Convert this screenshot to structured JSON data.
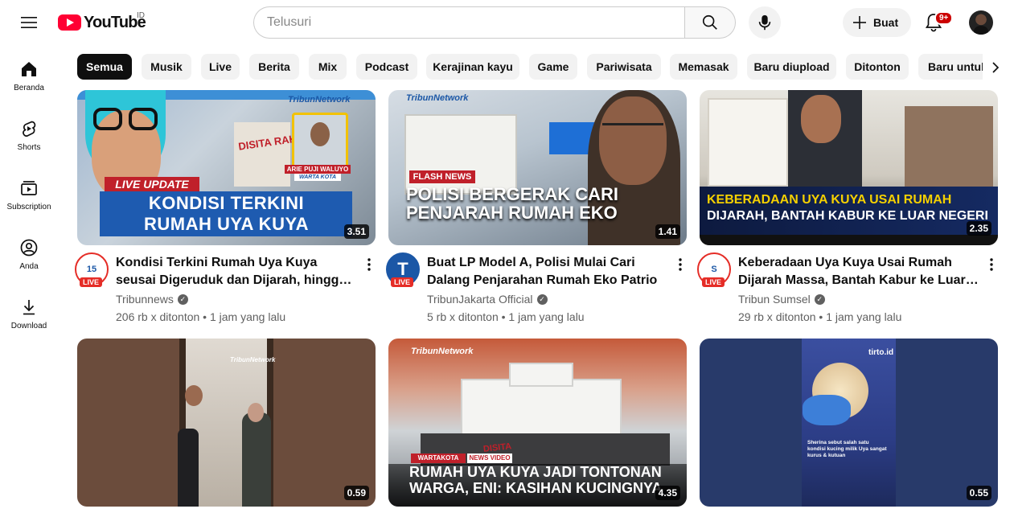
{
  "header": {
    "logo_text": "YouTube",
    "country_code": "ID",
    "search_placeholder": "Telusuri",
    "create_label": "Buat",
    "notification_badge": "9+"
  },
  "sidebar": {
    "items": [
      {
        "label": "Beranda",
        "icon": "home-icon"
      },
      {
        "label": "Shorts",
        "icon": "shorts-icon"
      },
      {
        "label": "Subscription",
        "icon": "subscriptions-icon"
      },
      {
        "label": "Anda",
        "icon": "you-icon"
      },
      {
        "label": "Download",
        "icon": "download-icon"
      }
    ]
  },
  "chips": [
    {
      "label": "Semua",
      "active": true
    },
    {
      "label": "Musik"
    },
    {
      "label": "Live"
    },
    {
      "label": "Berita"
    },
    {
      "label": "Mix"
    },
    {
      "label": "Podcast"
    },
    {
      "label": "Kerajinan kayu"
    },
    {
      "label": "Game"
    },
    {
      "label": "Pariwisata"
    },
    {
      "label": "Memasak"
    },
    {
      "label": "Baru diupload"
    },
    {
      "label": "Ditonton"
    },
    {
      "label": "Baru untuk Anda"
    }
  ],
  "videos": [
    {
      "title": "Kondisi Terkini Rumah Uya Kuya seusai Digeruduk dan Dijarah, hingga Komentar Warga",
      "channel": "Tribunnews",
      "views": "206 rb x ditonton",
      "age": "1 jam yang lalu",
      "duration": "3.51",
      "live": "LIVE",
      "avatar_text": "15",
      "thumb_brand": "TribunNetwork",
      "thumb_tag": "LIVE UPDATE",
      "thumb_headline_1": "KONDISI TERKINI",
      "thumb_headline_2": "RUMAH UYA KUYA",
      "thumb_person": "ARIE PUJI WALUYO",
      "thumb_person_org": "WARTA KOTA",
      "thumb_sign": "DISITA RAKYAT"
    },
    {
      "title": "Buat LP Model A, Polisi Mulai Cari Dalang Penjarahan Rumah Eko Patrio",
      "channel": "TribunJakarta Official",
      "views": "5 rb x ditonton",
      "age": "1 jam yang lalu",
      "duration": "1.41",
      "live": "LIVE",
      "avatar_text": "T",
      "thumb_brand": "TribunNetwork",
      "thumb_tag": "FLASH NEWS",
      "thumb_headline_1": "POLISI BERGERAK CARI",
      "thumb_headline_2": "PENJARAH RUMAH EKO"
    },
    {
      "title": "Keberadaan Uya Kuya Usai Rumah Dijarah Massa, Bantah Kabur ke Luar Negeri: Saya Masih di Indonesia",
      "channel": "Tribun Sumsel",
      "views": "29 rb x ditonton",
      "age": "1 jam yang lalu",
      "duration": "2.35",
      "live": "LIVE",
      "avatar_text": "S",
      "thumb_headline_1": "KEBERADAAN UYA KUYA USAI RUMAH",
      "thumb_headline_2": "DIJARAH, BANTAH KABUR KE LUAR NEGERI"
    },
    {
      "duration": "0.59",
      "thumb_brand": "TribunNetwork"
    },
    {
      "duration": "4.35",
      "thumb_brand": "TribunNetwork",
      "thumb_tag_a": "WARTAKOTA",
      "thumb_tag": "NEWS VIDEO",
      "thumb_headline_1": "RUMAH UYA KUYA JADI TONTONAN",
      "thumb_headline_2": "WARGA, ENI: KASIHAN KUCINGNYA",
      "thumb_sign": "DISITA"
    },
    {
      "duration": "0.55",
      "thumb_brand": "tirto.id",
      "thumb_caption": "Sherina sebut salah satu kondisi kucing milik Uya sangat kurus & kutuan"
    }
  ],
  "colors": {
    "accent": "#ff0033",
    "live": "#e52d27",
    "chip_active": "#0f0f0f"
  }
}
